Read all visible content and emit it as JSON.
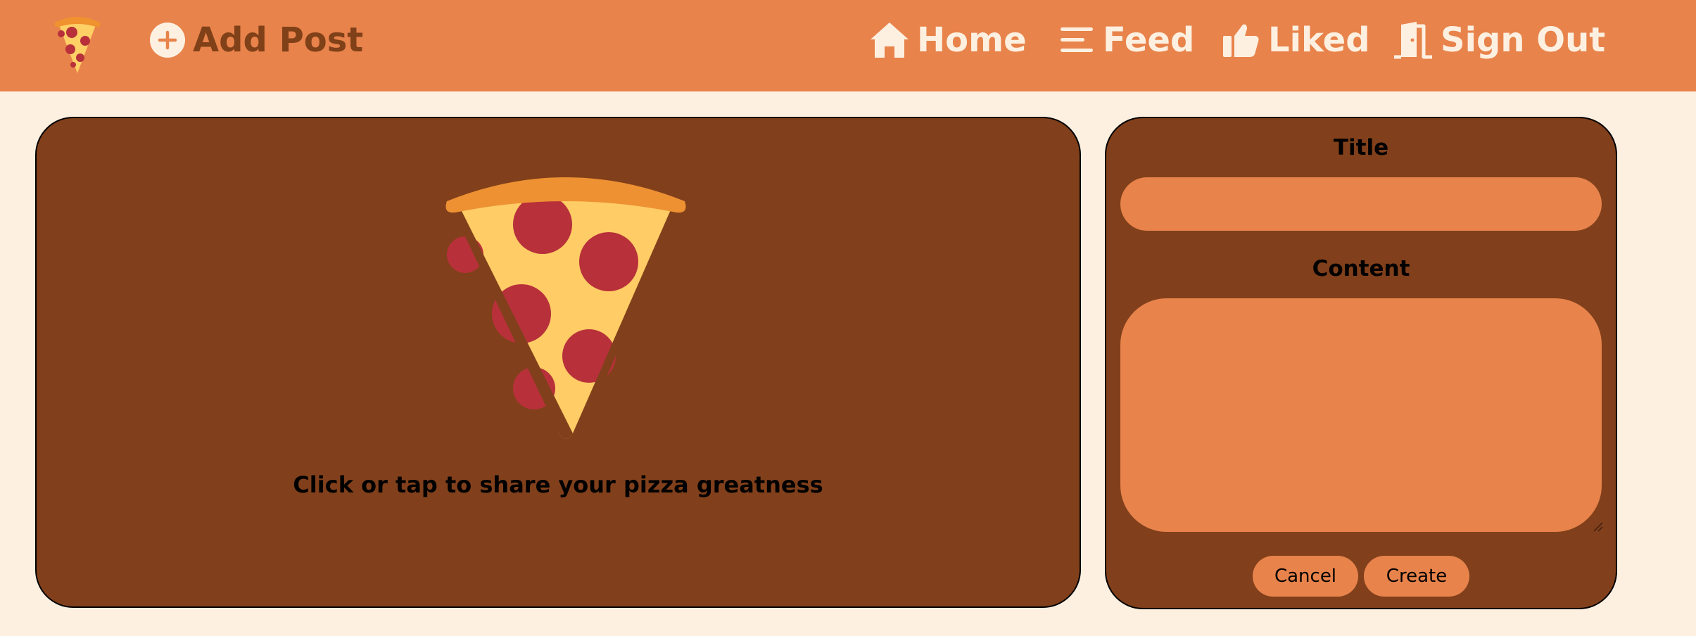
{
  "nav": {
    "add_post": "Add Post",
    "home": "Home",
    "feed": "Feed",
    "liked": "Liked",
    "sign_out": "Sign Out"
  },
  "upload": {
    "prompt": "Click or tap to share your pizza greatness"
  },
  "form": {
    "title_label": "Title",
    "title_value": "",
    "content_label": "Content",
    "content_value": "",
    "cancel_label": "Cancel",
    "create_label": "Create"
  },
  "icons": {
    "logo": "pizza-slice-icon",
    "add_post": "plus-circle-icon",
    "home": "house-icon",
    "feed": "menu-lines-icon",
    "liked": "thumbs-up-icon",
    "sign_out": "door-icon",
    "upload": "pizza-slice-icon"
  },
  "colors": {
    "navbar": "#e8834b",
    "background": "#fdf0e1",
    "card": "#81401b",
    "input": "#e8834b",
    "nav_text": "#fdf0e1",
    "add_post_text": "#804018"
  }
}
